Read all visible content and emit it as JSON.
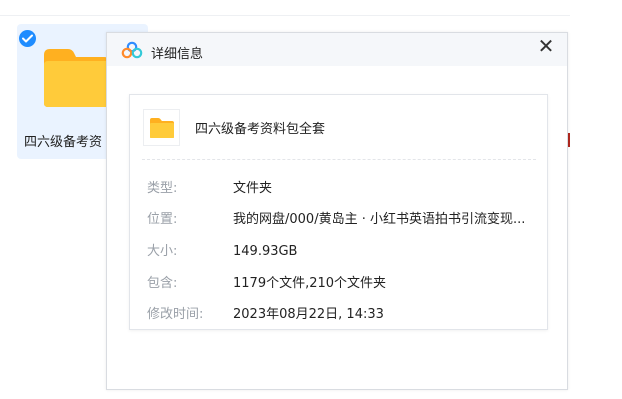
{
  "background": {
    "file_tile": {
      "label": "四六级备考资",
      "selected": true
    }
  },
  "dialog": {
    "title": "详细信息",
    "close_label": "✕",
    "item": {
      "name": "四六级备考资料包全套"
    },
    "rows": [
      {
        "label": "类型:",
        "value": "文件夹"
      },
      {
        "label": "位置:",
        "value": "我的网盘/000/黄岛主 · 小红书英语拍书引流变现..."
      },
      {
        "label": "大小:",
        "value": "149.93GB"
      },
      {
        "label": "包含:",
        "value": "1179个文件,210个文件夹"
      },
      {
        "label": "修改时间:",
        "value": "2023年08月22日, 14:33"
      }
    ]
  },
  "colors": {
    "accent": "#1f8cff",
    "folder": "#ffc933",
    "selection": "#eaf3ff"
  }
}
